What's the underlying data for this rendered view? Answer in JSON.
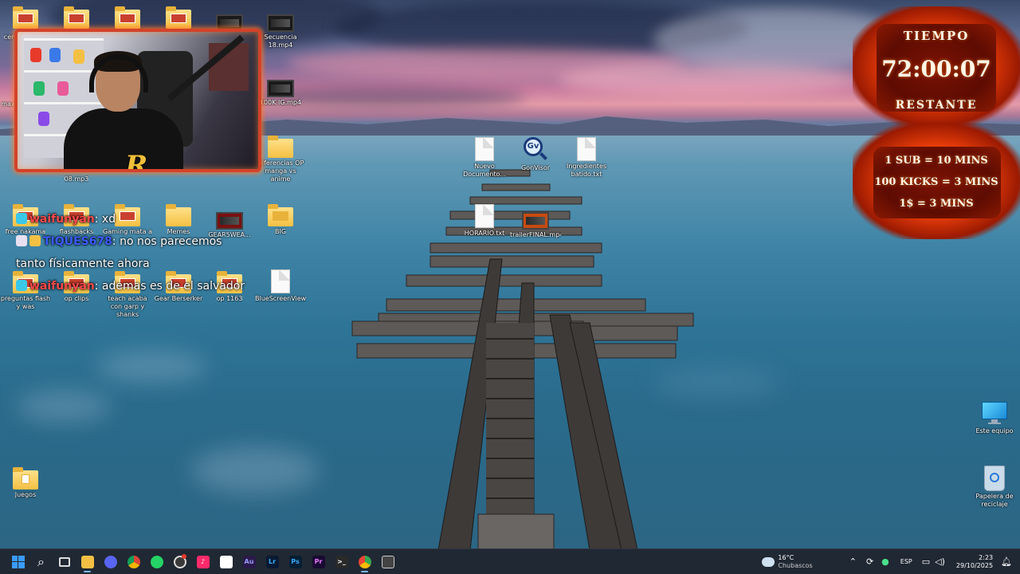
{
  "desktop": {
    "icons_left": [
      {
        "label": "",
        "kind": "folder"
      },
      {
        "label": "",
        "kind": "folder"
      },
      {
        "label": "",
        "kind": "folder"
      },
      {
        "label": "",
        "kind": "folder"
      },
      {
        "label": "",
        "kind": "video"
      },
      {
        "label": "Secuencia 18.mp4",
        "kind": "video"
      },
      {
        "label": "100K IG.mp4",
        "kind": "video"
      },
      {
        "label": "Diferencias OP manga vs anime",
        "kind": "folder"
      },
      {
        "label": "free nakama",
        "kind": "folder"
      },
      {
        "label": "flashbacks",
        "kind": "folder"
      },
      {
        "label": "Gaming mata a",
        "kind": "folder"
      },
      {
        "label": "Memes",
        "kind": "folder"
      },
      {
        "label": "GEAR5WEA...",
        "kind": "video"
      },
      {
        "label": "BIG",
        "kind": "folder"
      },
      {
        "label": "preguntas flash y was",
        "kind": "folder"
      },
      {
        "label": "op clips",
        "kind": "folder"
      },
      {
        "label": "teach acaba con garp y shanks",
        "kind": "folder"
      },
      {
        "label": "Gear Berserker",
        "kind": "folder"
      },
      {
        "label": "op 1163",
        "kind": "folder"
      },
      {
        "label": "BlueScreenView...",
        "kind": "doc"
      },
      {
        "label": "Juegos",
        "kind": "folder"
      }
    ],
    "icons_center": [
      {
        "label": "Nuevo Documento...",
        "kind": "doc"
      },
      {
        "label": "GonVisor",
        "kind": "app"
      },
      {
        "label": "Ingredientes batido.txt",
        "kind": "doc"
      },
      {
        "label": "HORARIO.txt",
        "kind": "doc"
      },
      {
        "label": "trailerFINAL.mp4",
        "kind": "video"
      }
    ],
    "icons_right": [
      {
        "label": "Este equipo",
        "kind": "pc"
      },
      {
        "label": "Papelera de reciclaje",
        "kind": "bin"
      }
    ],
    "partial_labels": {
      "a": "m",
      "b": "cen",
      "c": "max",
      "d": "08.mp3"
    }
  },
  "webcam": {
    "logo": "R"
  },
  "chat": [
    {
      "user": "waifunyan",
      "text": ": xd",
      "color": "#ff4a4a"
    },
    {
      "user": "TIQUES678",
      "text": ": no nos parecemos",
      "color": "#3a5bff"
    },
    {
      "user": "",
      "text": "tanto físicamente ahora",
      "color": "#ffffff"
    },
    {
      "user": "waifunyan",
      "text": ": ademas es de el salvador",
      "color": "#ff4a4a"
    }
  ],
  "timer": {
    "title": "TIEMPO",
    "time": "72:00:07",
    "subtitle": "RESTANTE",
    "rules": [
      "1 SUB = 10 MINS",
      "100 KICKS = 3 MINS",
      "1$ = 3 MINS"
    ]
  },
  "taskbar": {
    "apps": [
      {
        "name": "windows-start",
        "color": "#3a9bff",
        "glyph": ""
      },
      {
        "name": "search",
        "color": "transparent",
        "glyph": "⌕"
      },
      {
        "name": "task-view",
        "color": "transparent",
        "glyph": "▭"
      },
      {
        "name": "file-explorer",
        "color": "#f4c043",
        "glyph": ""
      },
      {
        "name": "discord",
        "color": "#5865f2",
        "glyph": ""
      },
      {
        "name": "chrome",
        "color": "#db4437",
        "glyph": ""
      },
      {
        "name": "whatsapp",
        "color": "#25d366",
        "glyph": ""
      },
      {
        "name": "obs",
        "color": "#3a3a3a",
        "glyph": ""
      },
      {
        "name": "tiktok",
        "color": "#ff2a6a",
        "glyph": "♪"
      },
      {
        "name": "capcut",
        "color": "#ffffff",
        "glyph": ""
      },
      {
        "name": "audition",
        "color": "#2a1a4a",
        "glyph": "Au"
      },
      {
        "name": "lightroom",
        "color": "#0a1a33",
        "glyph": "Lr"
      },
      {
        "name": "photoshop",
        "color": "#061e33",
        "glyph": "Ps"
      },
      {
        "name": "premiere",
        "color": "#1a0a33",
        "glyph": "Pr"
      },
      {
        "name": "terminal",
        "color": "#2a2a2a",
        "glyph": ">_"
      },
      {
        "name": "chrome-alt",
        "color": "#34a853",
        "glyph": ""
      },
      {
        "name": "clipper",
        "color": "#444444",
        "glyph": ""
      }
    ],
    "weather": {
      "temp": "16°C",
      "desc": "Chubascos"
    },
    "lang": "ESP",
    "time": "2:23",
    "date": "29/10/2025"
  }
}
